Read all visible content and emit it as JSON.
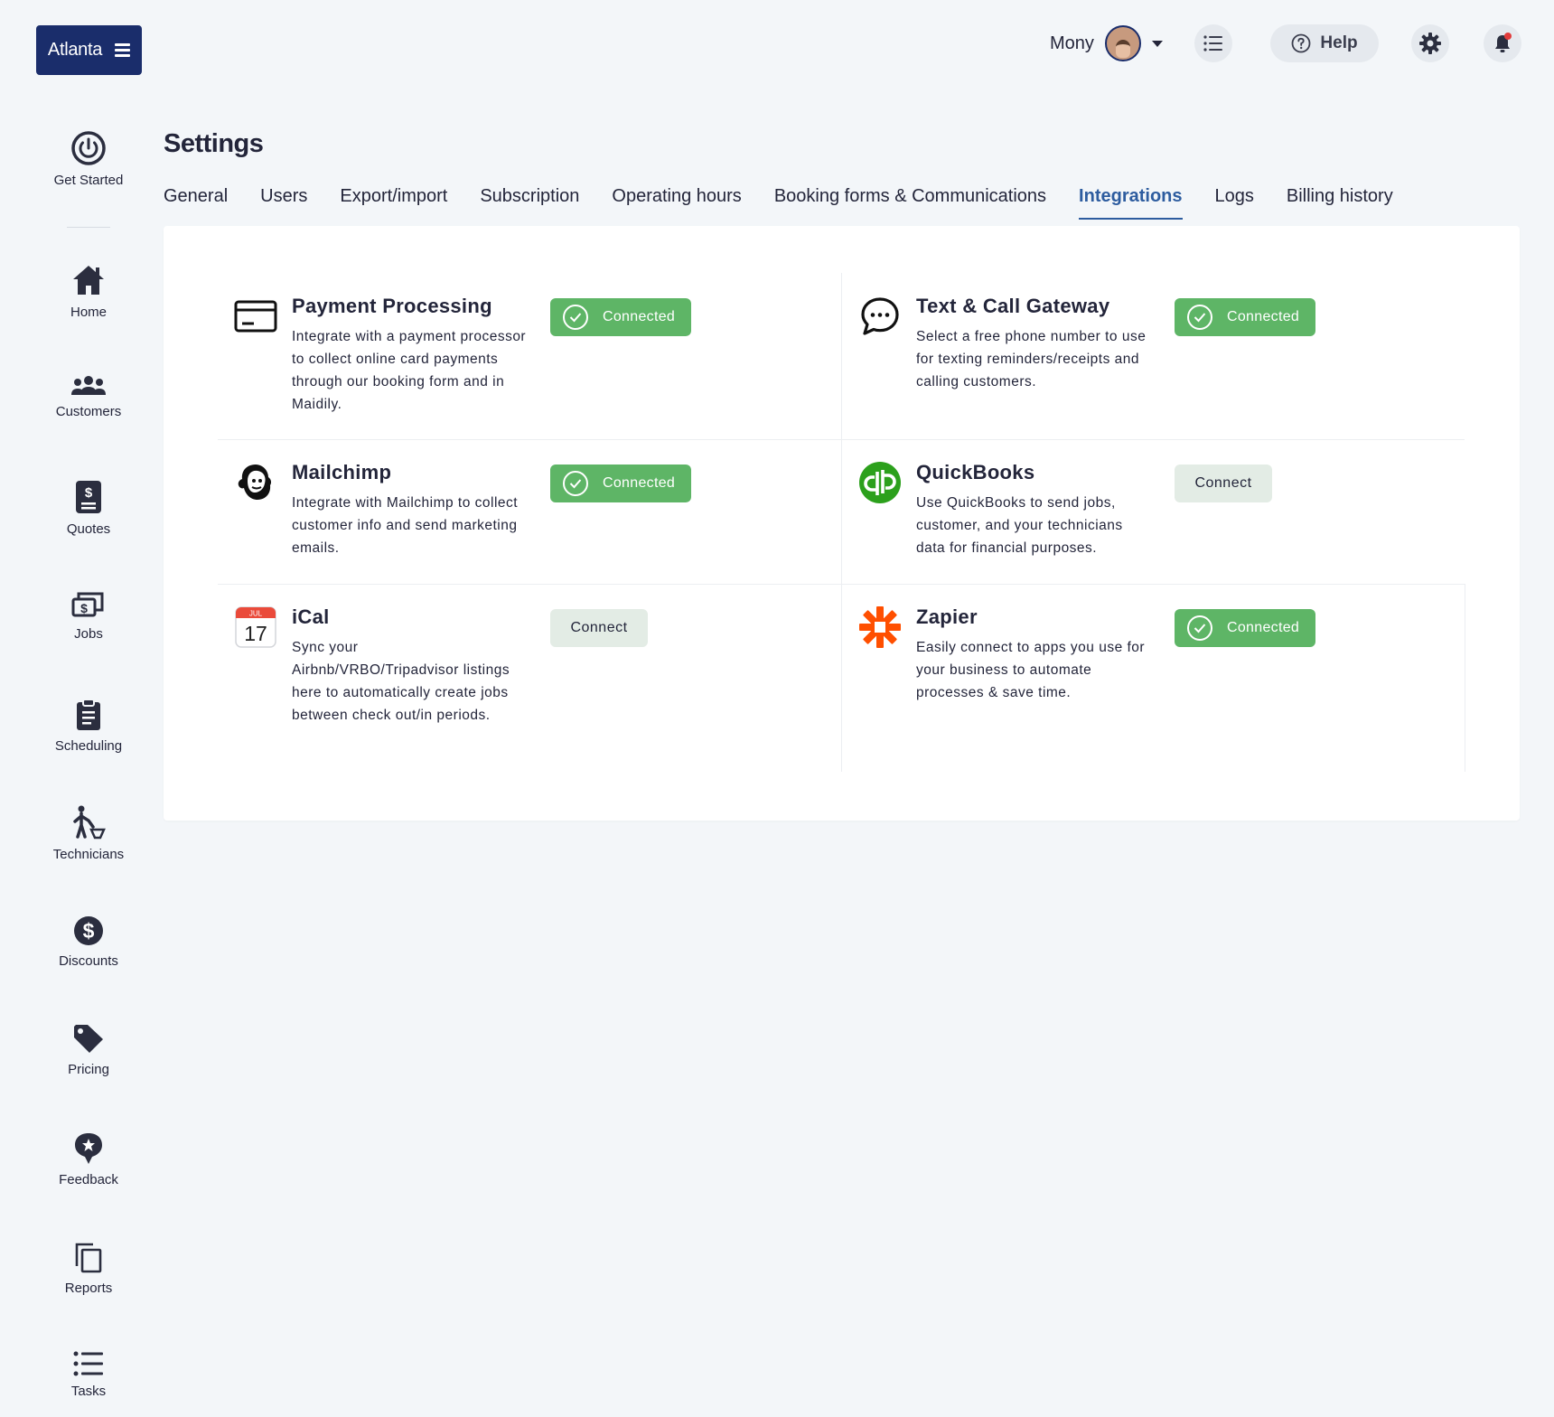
{
  "brand": {
    "name": "Atlanta"
  },
  "topbar": {
    "user_name": "Mony",
    "help_label": "Help"
  },
  "sidebar": {
    "items": [
      {
        "label": "Get Started",
        "icon": "power-icon"
      },
      {
        "label": "Home",
        "icon": "home-icon"
      },
      {
        "label": "Customers",
        "icon": "users-icon"
      },
      {
        "label": "Quotes",
        "icon": "quote-icon"
      },
      {
        "label": "Jobs",
        "icon": "jobs-icon"
      },
      {
        "label": "Scheduling",
        "icon": "clipboard-icon"
      },
      {
        "label": "Technicians",
        "icon": "technician-icon"
      },
      {
        "label": "Discounts",
        "icon": "dollar-icon"
      },
      {
        "label": "Pricing",
        "icon": "tag-icon"
      },
      {
        "label": "Feedback",
        "icon": "feedback-icon"
      },
      {
        "label": "Reports",
        "icon": "reports-icon"
      },
      {
        "label": "Tasks",
        "icon": "tasks-icon"
      }
    ]
  },
  "page": {
    "title": "Settings",
    "tabs": [
      {
        "label": "General"
      },
      {
        "label": "Users"
      },
      {
        "label": "Export/import"
      },
      {
        "label": "Subscription"
      },
      {
        "label": "Operating hours"
      },
      {
        "label": "Booking forms & Communications"
      },
      {
        "label": "Integrations",
        "active": true
      },
      {
        "label": "Logs"
      },
      {
        "label": "Billing history"
      }
    ]
  },
  "integrations": [
    {
      "title": "Payment Processing",
      "description": "Integrate with a payment processor to collect online card payments through our booking form and in Maidily.",
      "status": "Connected",
      "icon": "credit-card-icon"
    },
    {
      "title": "Text & Call Gateway",
      "description": "Select a free phone number to use for texting reminders/receipts and calling customers.",
      "status": "Connected",
      "icon": "chat-bubble-icon"
    },
    {
      "title": "Mailchimp",
      "description": "Integrate with Mailchimp to collect customer info and send marketing emails.",
      "status": "Connected",
      "icon": "mailchimp-icon"
    },
    {
      "title": "QuickBooks",
      "description": "Use QuickBooks to send jobs, customer, and your technicians data for financial purposes.",
      "status": "Connect",
      "icon": "quickbooks-icon"
    },
    {
      "title": "iCal",
      "description": "Sync your Airbnb/VRBO/Tripadvisor listings here to automatically create jobs between check out/in periods.",
      "status": "Connect",
      "icon": "calendar-icon",
      "cal_month": "JUL",
      "cal_day": "17"
    },
    {
      "title": "Zapier",
      "description": "Easily connect to apps you use for your business to automate processes & save time.",
      "status": "Connected",
      "icon": "zapier-icon"
    }
  ],
  "colors": {
    "brand": "#1a2d6b",
    "accent": "#2d5c9f",
    "connected": "#5eb566",
    "connect_bg": "#e3ece5",
    "notification_dot": "#e23b3b",
    "quickbooks": "#2ca01c",
    "zapier": "#ff4f00"
  }
}
